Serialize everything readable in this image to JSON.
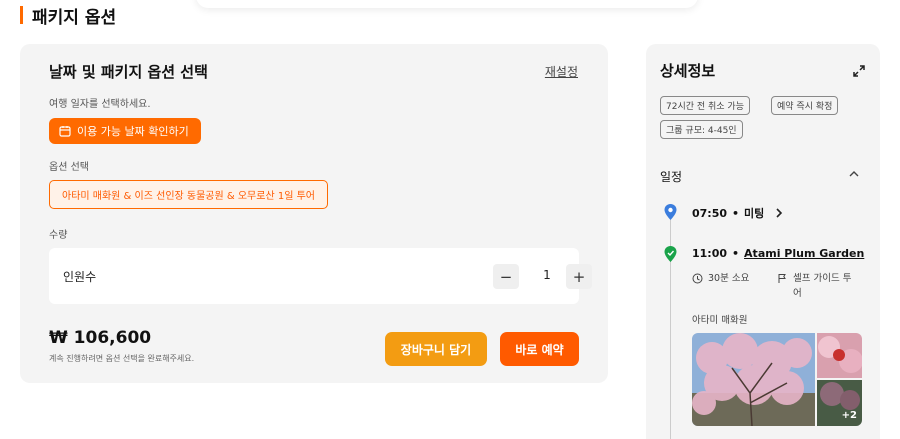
{
  "section": {
    "title": "패키지 옵션"
  },
  "booking": {
    "title": "날짜 및 패키지 옵션 선택",
    "reset_label": "재설정",
    "date_prompt": "여행 일자를 선택하세요.",
    "date_button": "이용 가능 날짜 확인하기",
    "option_label": "옵션 선택",
    "option_value": "아타미 매화원 & 이즈 선인장 동물공원 & 오무로산 1일 투어",
    "quantity_label": "수량",
    "quantity_row_label": "인원수",
    "quantity_value": "1",
    "minus": "−",
    "plus": "+",
    "price": "₩ 106,600",
    "price_note": "계속 진행하려면 옵션 선택을 완료해주세요.",
    "cart_button": "장바구니 담기",
    "book_button": "바로 예약"
  },
  "details": {
    "title": "상세정보",
    "tags": [
      "72시간 전 취소 가능",
      "예약 즉시 확정",
      "그룹 규모: 4-45인"
    ],
    "schedule_title": "일정",
    "steps": [
      {
        "time": "07:50",
        "sep": "•",
        "name": "미팅"
      },
      {
        "time": "11:00",
        "sep": "•",
        "name": "Atami Plum Garden",
        "duration": "30분 소요",
        "type": "셀프 가이드 투어",
        "sub": "아타미 매화원",
        "more_photos": "+2"
      }
    ]
  },
  "colors": {
    "accent": "#ff6a00",
    "cart": "#f39c12",
    "card_bg": "#f4f4f4",
    "pin_blue": "#3b7ddd",
    "pin_green": "#1aa34a"
  },
  "icons": [
    "calendar-icon",
    "expand-icon",
    "chevron-up-icon",
    "location-pin-icon",
    "chevron-right-icon",
    "clock-icon",
    "flag-icon"
  ]
}
